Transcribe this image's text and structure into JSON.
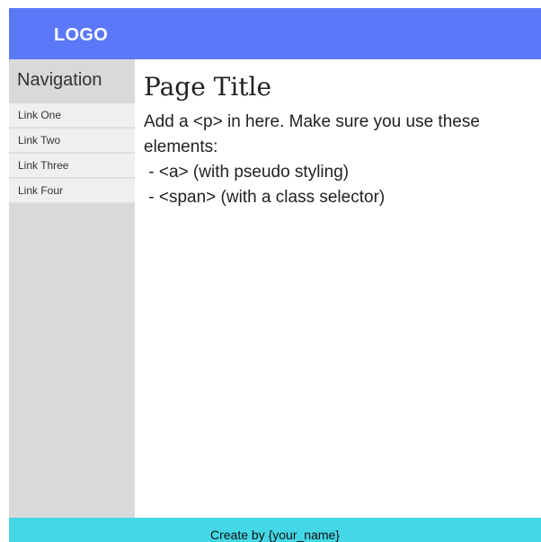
{
  "header": {
    "logo": "LOGO"
  },
  "sidebar": {
    "title": "Navigation",
    "items": [
      {
        "label": "Link One"
      },
      {
        "label": "Link Two"
      },
      {
        "label": "Link Three"
      },
      {
        "label": "Link Four"
      }
    ]
  },
  "main": {
    "title": "Page Title",
    "paragraph_lines": [
      "Add a <p> in here. Make sure you use these",
      "elements:",
      " - <a> (with pseudo styling)",
      " - <span> (with a class selector)"
    ]
  },
  "footer": {
    "text": "Create by {your_name}"
  },
  "colors": {
    "header": "#5a78f7",
    "sidebar": "#d9d9d9",
    "nav_item": "#efefef",
    "footer": "#44d7e6"
  }
}
